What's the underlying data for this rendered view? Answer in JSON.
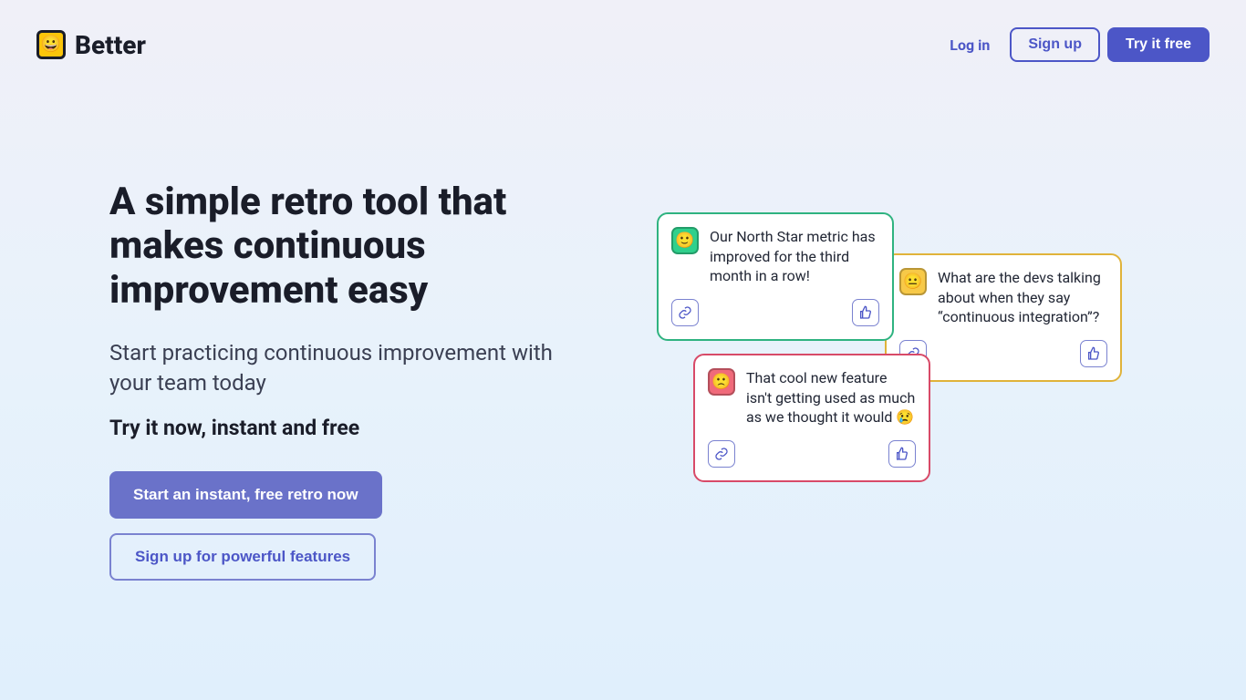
{
  "brand": {
    "name": "Better",
    "emoji": "😀"
  },
  "nav": {
    "login": "Log in",
    "signup": "Sign up",
    "try": "Try it free"
  },
  "hero": {
    "headline": "A simple retro tool that makes continuous improvement easy",
    "subhead": "Start practicing continuous improvement with your team today",
    "tryline": "Try it now, instant and free",
    "cta_primary": "Start an instant, free retro now",
    "cta_secondary": "Sign up for powerful features"
  },
  "cards": {
    "green": {
      "emoji": "🙂",
      "text": "Our North Star metric has improved for the third month in a row!"
    },
    "yellow": {
      "emoji": "😐",
      "text": "What are the devs talking about when they say “continuous integration”?"
    },
    "pink": {
      "emoji": "🙁",
      "text": "That cool new feature isn't getting used as much as we thought it would 😢"
    }
  }
}
